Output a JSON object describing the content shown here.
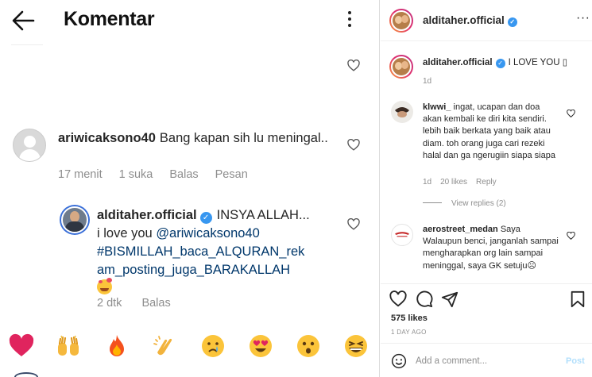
{
  "left_panel": {
    "title": "Komentar",
    "comments": [
      {
        "username": "ariwicaksono40",
        "text": "Bang kapan sih lu meningal..",
        "time": "17 menit",
        "likes": "1 suka",
        "reply_label": "Balas",
        "message_label": "Pesan"
      },
      {
        "username": "alditaher.official",
        "text_intro": "INSYA ALLAH...",
        "text_love": "i love you",
        "mention": "@ariwicaksono40",
        "hashtag_line1": "#BISMILLAH_baca_ALQURAN_rek",
        "hashtag_line2": "am_posting_juga_BARAKALLAH",
        "time": "2 dtk",
        "reply_label": "Balas"
      }
    ],
    "emoji_bar": [
      "red-heart",
      "raising-hands",
      "fire",
      "clapping-hands",
      "crying-face",
      "heart-eyes-face",
      "astonished-face",
      "grinning-squinting-face"
    ]
  },
  "right_panel": {
    "header_username": "alditaher.official",
    "caption": {
      "username": "alditaher.official",
      "text": "I LOVE YOU ▯",
      "time": "1d"
    },
    "comments": [
      {
        "username": "klwwi_",
        "text": "ingat, ucapan dan doa akan kembali ke diri kita sendiri. lebih baik berkata yang baik atau diam. toh orang juga cari rezeki halal dan ga ngerugiin siapa siapa",
        "time": "1d",
        "likes": "20 likes",
        "reply_label": "Reply",
        "view_replies": "View replies (2)"
      },
      {
        "username": "aerostreet_medan",
        "text": "Saya Walaupun benci, janganlah sampai mengharapkan org lain sampai meninggal, saya GK setuju☹"
      }
    ],
    "likes": "575 likes",
    "date": "1 DAY AGO",
    "add_comment_placeholder": "Add a comment...",
    "post_label": "Post"
  },
  "colors": {
    "verified_blue": "#3897f0",
    "muted_text": "#8e8e8e",
    "post_disabled": "#b2dffc",
    "mention_blue": "#00376b"
  }
}
